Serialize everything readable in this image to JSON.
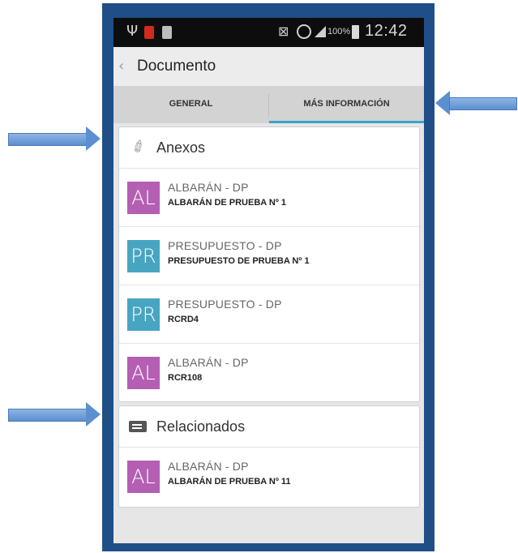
{
  "status_bar": {
    "battery": "100%",
    "time": "12:42",
    "icons": [
      "usb-icon",
      "app-notification-icon",
      "sd-card-icon",
      "no-signal-icon",
      "alarm-icon",
      "signal-icon",
      "battery-icon"
    ]
  },
  "action_bar": {
    "back_icon": "chevron-left-icon",
    "title": "Documento"
  },
  "tabs": [
    {
      "label": "GENERAL",
      "active": false
    },
    {
      "label": "MÁS INFORMACIÓN",
      "active": true
    }
  ],
  "colors": {
    "frame": "#1f4f86",
    "tab_indicator": "#3aa3cf",
    "avatar_al": "#b45fb3",
    "avatar_pr": "#48a5c2",
    "arrow": "#5b8fd0"
  },
  "anexos": {
    "icon": "paperclip-icon",
    "title": "Anexos",
    "items": [
      {
        "initials": "AL",
        "type": "ALBARÁN - DP",
        "name": "ALBARÁN DE PRUEBA Nº 1"
      },
      {
        "initials": "PR",
        "type": "PRESUPUESTO - DP",
        "name": "PRESUPUESTO DE PRUEBA Nº 1"
      },
      {
        "initials": "PR",
        "type": "PRESUPUESTO - DP",
        "name": "RCRD4"
      },
      {
        "initials": "AL",
        "type": "ALBARÁN - DP",
        "name": "RCR108"
      }
    ]
  },
  "relacionados": {
    "icon": "list-icon",
    "title": "Relacionados",
    "items": [
      {
        "initials": "AL",
        "type": "ALBARÁN - DP",
        "name": "ALBARÁN DE PRUEBA Nº 11"
      }
    ]
  }
}
